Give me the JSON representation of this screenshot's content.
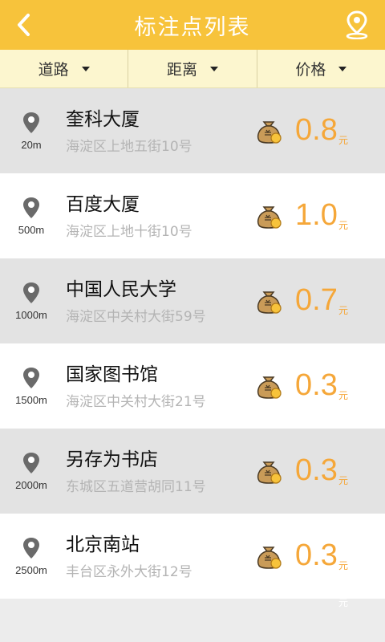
{
  "header": {
    "title": "标注点列表",
    "back_icon": "chevron-left-icon",
    "map_icon": "map-pin-icon"
  },
  "filters": [
    {
      "label": "道路"
    },
    {
      "label": "距离"
    },
    {
      "label": "价格"
    }
  ],
  "places": [
    {
      "name": "奎科大厦",
      "address": "海淀区上地五街10号",
      "distance": "20m",
      "price": "0.8",
      "unit": "元"
    },
    {
      "name": "百度大厦",
      "address": "海淀区上地十街10号",
      "distance": "500m",
      "price": "1.0",
      "unit": "元"
    },
    {
      "name": "中国人民大学",
      "address": "海淀区中关村大街59号",
      "distance": "1000m",
      "price": "0.7",
      "unit": "元"
    },
    {
      "name": "国家图书馆",
      "address": "海淀区中关村大街21号",
      "distance": "1500m",
      "price": "0.3",
      "unit": "元"
    },
    {
      "name": "另存为书店",
      "address": "东城区五道营胡同11号",
      "distance": "2000m",
      "price": "0.3",
      "unit": "元"
    },
    {
      "name": "北京南站",
      "address": "丰台区永外大街12号",
      "distance": "2500m",
      "price": "0.3",
      "unit": "元"
    }
  ],
  "footer": {
    "stray_unit": "元"
  },
  "colors": {
    "accent": "#f7c33b",
    "price": "#f5a739",
    "filter_bg": "#fcf6cf"
  }
}
